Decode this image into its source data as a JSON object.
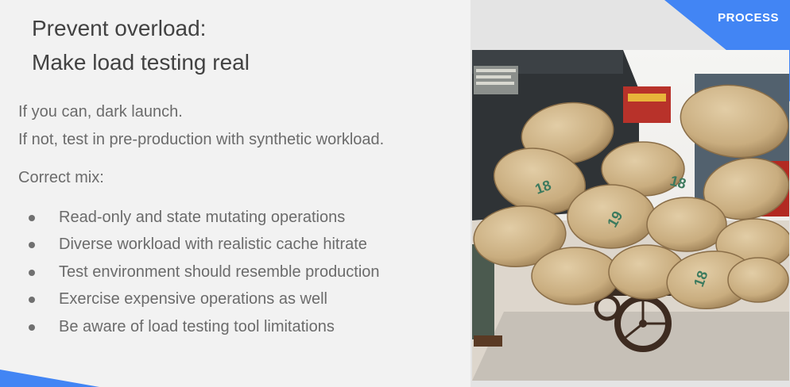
{
  "slide": {
    "corner_label": "PROCESS",
    "title_line1": "Prevent overload:",
    "title_line2": "Make load testing real",
    "intro_line1": "If you can, dark launch.",
    "intro_line2": "If not, test in pre-production with synthetic workload.",
    "mix_heading": "Correct mix:",
    "bullets": [
      "Read-only and state mutating operations",
      "Diverse workload with realistic cache hitrate",
      "Test environment should resemble production",
      "Exercise expensive operations as well",
      "Be aware of load testing tool limitations"
    ],
    "photo": {
      "subject": "cart-overloaded-with-sacks",
      "sack_markings": [
        "18",
        "18",
        "19",
        "18"
      ]
    },
    "accent_color": "#4285f4"
  }
}
